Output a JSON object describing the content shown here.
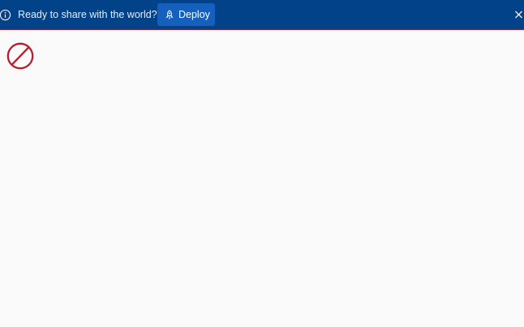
{
  "banner": {
    "message": "Ready to share with the world?",
    "deploy_label": "Deploy",
    "info_icon": "info-circle-icon",
    "deploy_icon": "rocket-icon",
    "close_icon": "close-icon",
    "background_color": "#024288",
    "button_color": "#1660bd",
    "border_color": "#a31d2c"
  },
  "main": {
    "status_icon": "prohibited-icon",
    "status_icon_color": "#b5202e"
  }
}
